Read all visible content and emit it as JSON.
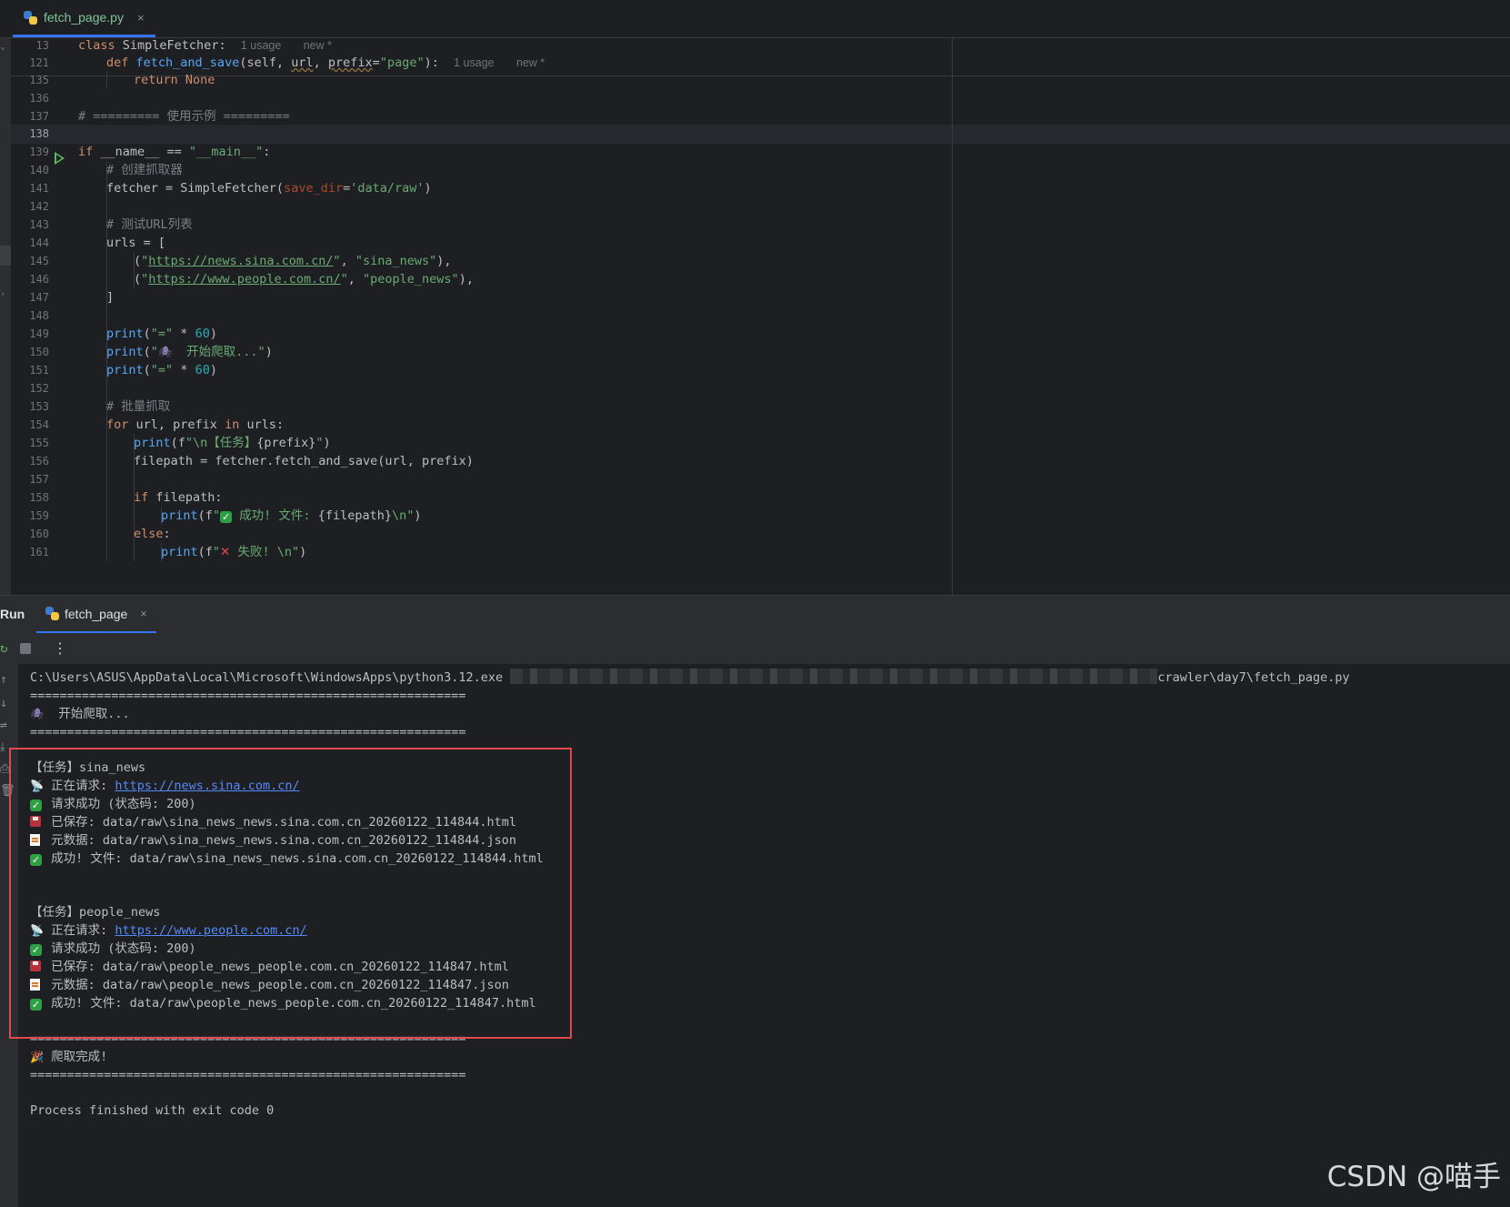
{
  "editor_tab": {
    "filename": "fetch_page.py",
    "close": "×"
  },
  "sticky": {
    "line13": {
      "ln": "13",
      "code": "class SimpleFetcher:",
      "hint_usage": "1 usage",
      "hint_new": "new *"
    },
    "line121": {
      "ln": "121",
      "code_def": "def",
      "fn": "fetch_and_save",
      "params_a": "(self, ",
      "url": "url",
      "comma": ", ",
      "prefix": "prefix",
      "eq": "=",
      "default": "\"page\"",
      "close": "):",
      "hint_usage": "1 usage",
      "hint_new": "new *"
    }
  },
  "code_lines": {
    "l135": {
      "ln": "135",
      "kw": "return",
      "val": " None"
    },
    "l136": {
      "ln": "136"
    },
    "l137": {
      "ln": "137",
      "comment": "# ========= 使用示例 ========="
    },
    "l138": {
      "ln": "138"
    },
    "l139": {
      "ln": "139",
      "kw": "if",
      "t1": " __name__ == ",
      "str": "\"__main__\"",
      "t2": ":"
    },
    "l140": {
      "ln": "140",
      "comment": "# 创建抓取器"
    },
    "l141": {
      "ln": "141",
      "t1": "fetcher = SimpleFetcher(",
      "param": "save_dir",
      "t2": "=",
      "str": "'data/raw'",
      "t3": ")"
    },
    "l142": {
      "ln": "142"
    },
    "l143": {
      "ln": "143",
      "comment": "# 测试URL列表"
    },
    "l144": {
      "ln": "144",
      "t1": "urls = ["
    },
    "l145": {
      "ln": "145",
      "t1": "(",
      "q1": "\"",
      "url": "https://news.sina.com.cn/",
      "q2": "\"",
      "t2": ", ",
      "str": "\"sina_news\"",
      "t3": "),"
    },
    "l146": {
      "ln": "146",
      "t1": "(",
      "q1": "\"",
      "url": "https://www.people.com.cn/",
      "q2": "\"",
      "t2": ", ",
      "str": "\"people_news\"",
      "t3": "),"
    },
    "l147": {
      "ln": "147",
      "t1": "]"
    },
    "l148": {
      "ln": "148"
    },
    "l149": {
      "ln": "149",
      "fn": "print",
      "t1": "(",
      "str": "\"=\"",
      "t2": " * ",
      "num": "60",
      "t3": ")"
    },
    "l150": {
      "ln": "150",
      "fn": "print",
      "t1": "(",
      "q1": "\"",
      "emoji": "🕷",
      "str": "  开始爬取...\"",
      "t3": ")"
    },
    "l151": {
      "ln": "151",
      "fn": "print",
      "t1": "(",
      "str": "\"=\"",
      "t2": " * ",
      "num": "60",
      "t3": ")"
    },
    "l152": {
      "ln": "152"
    },
    "l153": {
      "ln": "153",
      "comment": "# 批量抓取"
    },
    "l154": {
      "ln": "154",
      "kw": "for",
      "t1": " url, prefix ",
      "kw2": "in",
      "t2": " urls:"
    },
    "l155": {
      "ln": "155",
      "fn": "print",
      "t1": "(f",
      "str1": "\"\\n【任务】",
      "t2": "{prefix}",
      "str2": "\"",
      "t3": ")"
    },
    "l156": {
      "ln": "156",
      "t1": "filepath = fetcher.fetch_and_save(url, prefix)"
    },
    "l157": {
      "ln": "157"
    },
    "l158": {
      "ln": "158",
      "kw": "if",
      "t1": " filepath:"
    },
    "l159": {
      "ln": "159",
      "fn": "print",
      "t1": "(f",
      "q1": "\"",
      "emoji": "✓",
      "str1": " 成功! 文件: ",
      "t2": "{filepath}",
      "str2": "\\n\"",
      "t3": ")"
    },
    "l160": {
      "ln": "160",
      "kw": "else",
      "t1": ":"
    },
    "l161": {
      "ln": "161",
      "fn": "print",
      "t1": "(f",
      "q1": "\"",
      "emoji": "✕",
      "str1": " 失败! \\n\"",
      "t3": ")"
    }
  },
  "run_panel": {
    "label": "Run",
    "tab": "fetch_page",
    "close": "×",
    "more": "⋮"
  },
  "console": {
    "cmd_a": "C:\\Users\\ASUS\\AppData\\Local\\Microsoft\\WindowsApps\\python3.12.exe ",
    "cmd_b": "crawler\\day7\\fetch_page.py",
    "sep": "===========================================================",
    "start": " 开始爬取...",
    "task1": {
      "title": "【任务】sina_news",
      "req_label": " 正在请求: ",
      "req_url": "https://news.sina.com.cn/",
      "ok": " 请求成功 (状态码: 200)",
      "saved": "已保存: data/raw\\sina_news_news.sina.com.cn_20260122_114844.html",
      "meta": "元数据: data/raw\\sina_news_news.sina.com.cn_20260122_114844.json",
      "done": " 成功! 文件: data/raw\\sina_news_news.sina.com.cn_20260122_114844.html"
    },
    "task2": {
      "title": "【任务】people_news",
      "req_label": " 正在请求: ",
      "req_url": "https://www.people.com.cn/",
      "ok": " 请求成功 (状态码: 200)",
      "saved": "已保存: data/raw\\people_news_people.com.cn_20260122_114847.html",
      "meta": "元数据: data/raw\\people_news_people.com.cn_20260122_114847.json",
      "done": " 成功! 文件: data/raw\\people_news_people.com.cn_20260122_114847.html"
    },
    "finish": " 爬取完成!",
    "exit": "Process finished with exit code 0"
  },
  "watermark": "CSDN @喵手",
  "colors": {
    "accent": "#3574f0",
    "highlight_box": "#e0484f",
    "keyword": "#cf8e6d",
    "string": "#6aab73",
    "function": "#56a8f5"
  }
}
